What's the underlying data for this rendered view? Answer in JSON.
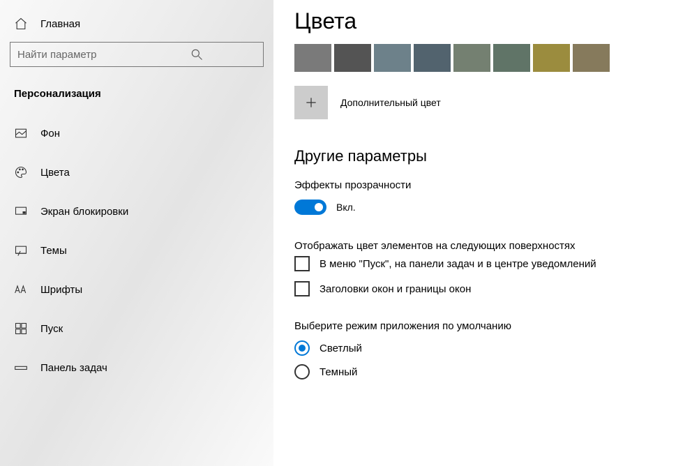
{
  "sidebar": {
    "home": "Главная",
    "searchPlaceholder": "Найти параметр",
    "category": "Персонализация",
    "items": [
      {
        "label": "Фон"
      },
      {
        "label": "Цвета"
      },
      {
        "label": "Экран блокировки"
      },
      {
        "label": "Темы"
      },
      {
        "label": "Шрифты"
      },
      {
        "label": "Пуск"
      },
      {
        "label": "Панель задач"
      }
    ]
  },
  "main": {
    "title": "Цвета",
    "swatches": [
      "#7a7a7a",
      "#545454",
      "#6d818a",
      "#52636e",
      "#748071",
      "#607467",
      "#9b8c3e",
      "#867a5c"
    ],
    "customColorLabel": "Дополнительный цвет",
    "otherOptionsTitle": "Другие параметры",
    "transparency": {
      "label": "Эффекты прозрачности",
      "state": "Вкл."
    },
    "accentOnSurfacesLabel": "Отображать цвет элементов на следующих поверхностях",
    "checkboxes": [
      "В меню \"Пуск\", на панели задач и в центре уведомлений",
      "Заголовки окон и границы окон"
    ],
    "appModeLabel": "Выберите режим приложения по умолчанию",
    "appModeOptions": [
      "Светлый",
      "Темный"
    ],
    "appModeSelected": 0
  }
}
